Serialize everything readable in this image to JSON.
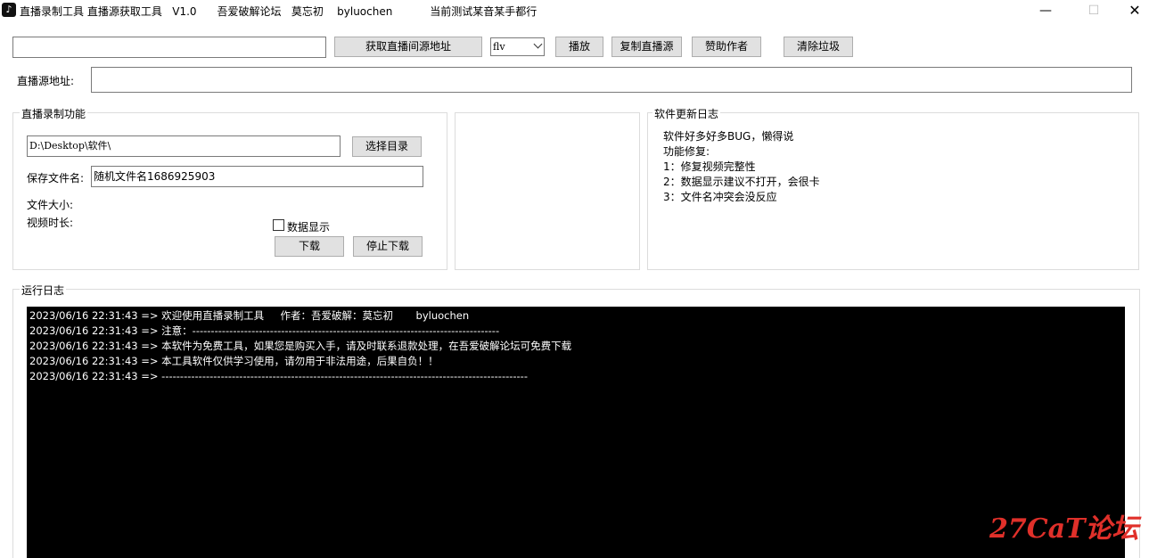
{
  "window": {
    "title": "直播录制工具 直播源获取工具   V1.0      吾爱破解论坛   莫忘初    byluochen           当前测试某音某手都行",
    "minimize": "—",
    "maximize": "☐",
    "close": "✕"
  },
  "toolbar": {
    "url_input_value": "",
    "fetch_button": "获取直播间源地址",
    "format_select": "flv",
    "play_button": "播放",
    "copy_button": "复制直播源",
    "sponsor_button": "赞助作者",
    "clear_button": "清除垃圾"
  },
  "source": {
    "label": "直播源地址:",
    "value": ""
  },
  "record": {
    "group_title": "直播录制功能",
    "dir_value": "D:\\Desktop\\软件\\",
    "choose_dir_button": "选择目录",
    "filename_label": "保存文件名:",
    "filename_value": "随机文件名1686925903",
    "filesize_label": "文件大小:",
    "duration_label": "视频时长:",
    "data_display_label": "数据显示",
    "download_button": "下载",
    "stop_button": "停止下载"
  },
  "changelog": {
    "group_title": "软件更新日志",
    "lines": [
      "软件好多好多BUG，懒得说",
      "功能修复:",
      "1：修复视频完整性",
      "2：数据显示建议不打开，会很卡",
      "3：文件名冲突会没反应"
    ]
  },
  "runlog": {
    "group_title": "运行日志",
    "lines": [
      "2023/06/16 22:31:43 => 欢迎使用直播录制工具     作者：吾爱破解：莫忘初       byluochen",
      "2023/06/16 22:31:43 => 注意：-----------------------------------------------------------------------------------",
      "2023/06/16 22:31:43 => 本软件为免费工具，如果您是购买入手，请及时联系退款处理，在吾爱破解论坛可免费下载",
      "2023/06/16 22:31:43 => 本工具软件仅供学习使用，请勿用于非法用途，后果自负！！",
      "2023/06/16 22:31:43 => ---------------------------------------------------------------------------------------------------"
    ]
  },
  "watermark": "27CaT论坛"
}
